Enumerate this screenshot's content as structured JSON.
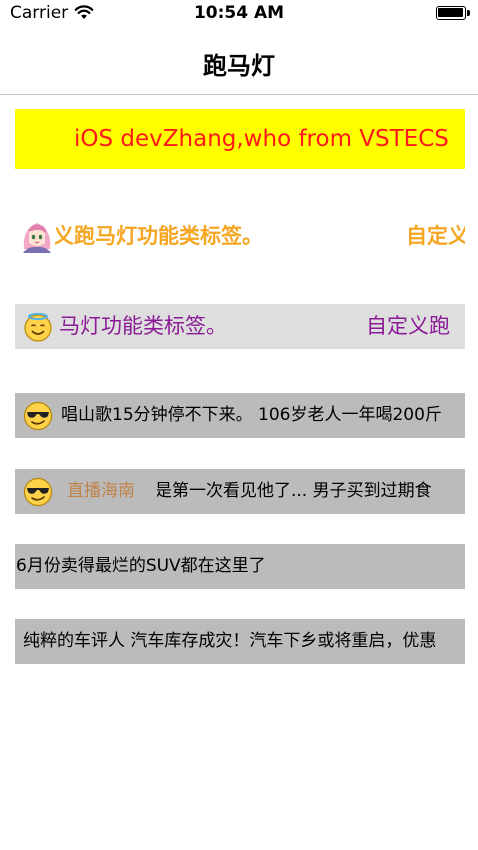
{
  "status_bar": {
    "carrier": "Carrier",
    "time": "10:54 AM"
  },
  "nav": {
    "title": "跑马灯"
  },
  "marquees": {
    "m1": {
      "text": "iOS devZhang,who from VSTECS",
      "bg": "#ffff00",
      "color": "#ff1a1a"
    },
    "m2": {
      "text_a": "义跑马灯功能类标签。",
      "text_b": "自定义",
      "color": "#f5a623"
    },
    "m3": {
      "text_a": "马灯功能类标签。",
      "text_b": "自定义跑",
      "bg": "#dedede",
      "color": "#8b1a96"
    },
    "m4": {
      "text": "唱山歌15分钟停不下来。   106岁老人一年喝200斤",
      "bg": "#bbbbbb"
    },
    "m5": {
      "tag": "直播海南",
      "text": "是第一次看见他了...   男子买到过期食",
      "bg": "#bbbbbb"
    },
    "m6": {
      "text": "6月份卖得最烂的SUV都在这里了",
      "bg": "#bbbbbb"
    },
    "m7": {
      "text": "纯粹的车评人   汽车库存成灾！汽车下乡或将重启，优惠",
      "bg": "#bbbbbb"
    }
  },
  "icons": {
    "wifi": "wifi-icon",
    "battery": "battery-icon",
    "m2_avatar": "anime-girl-avatar-icon",
    "m3_avatar": "halo-smiley-icon",
    "m4_avatar": "sunglasses-smiley-icon",
    "m5_avatar": "sunglasses-smiley-icon"
  }
}
